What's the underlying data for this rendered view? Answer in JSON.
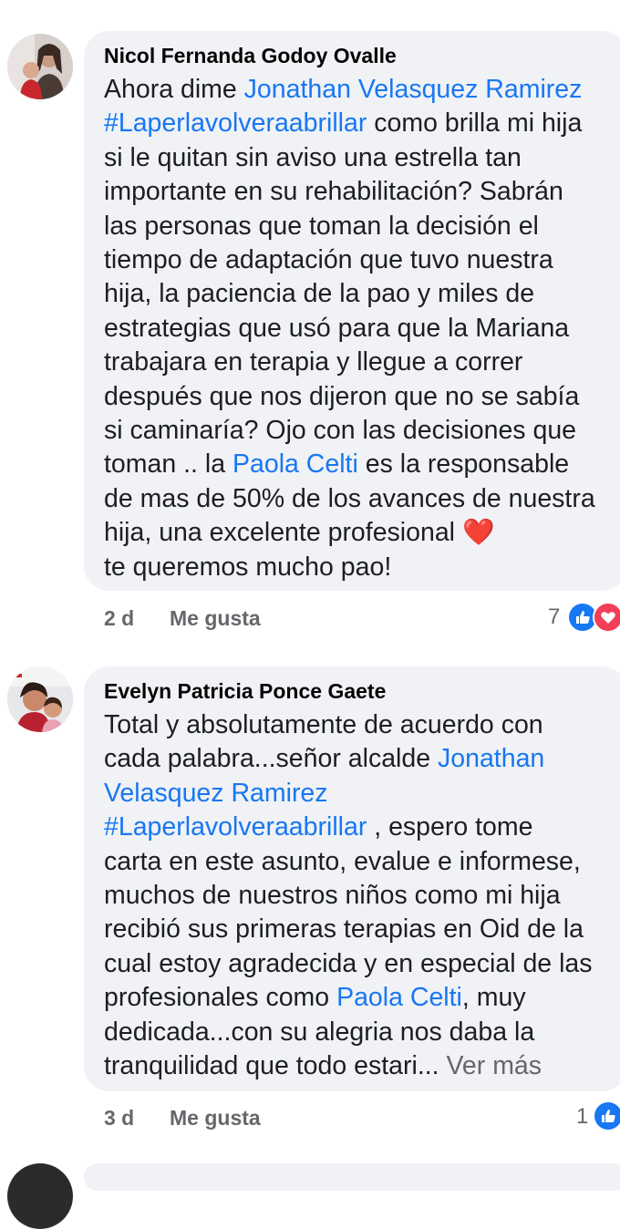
{
  "comments": [
    {
      "author": "Nicol Fernanda Godoy Ovalle",
      "lines": [
        [
          {
            "t": "Ahora dime "
          },
          {
            "t": "Jonathan Velasquez Ramirez",
            "m": true
          }
        ],
        [
          {
            "t": "#Laperlavolveraabrillar",
            "m": true
          },
          {
            "t": " como brilla mi hija"
          }
        ],
        [
          {
            "t": "si le quitan sin aviso una estrella tan"
          }
        ],
        [
          {
            "t": "importante en su rehabilitación? Sabrán"
          }
        ],
        [
          {
            "t": "las personas que toman la decisión el"
          }
        ],
        [
          {
            "t": "tiempo de adaptación que tuvo nuestra"
          }
        ],
        [
          {
            "t": "hija, la paciencia de la pao y miles de"
          }
        ],
        [
          {
            "t": "estrategias que usó para que la Mariana"
          }
        ],
        [
          {
            "t": "trabajara en terapia y llegue a correr"
          }
        ],
        [
          {
            "t": "después que nos dijeron que no se sabía"
          }
        ],
        [
          {
            "t": "si caminaría? Ojo con las decisiones que"
          }
        ],
        [
          {
            "t": "toman .. la "
          },
          {
            "t": "Paola Celti",
            "m": true
          },
          {
            "t": " es la responsable"
          }
        ],
        [
          {
            "t": "de mas de 50% de los avances de nuestra"
          }
        ],
        [
          {
            "t": "hija, una excelente profesional "
          },
          {
            "t": "❤️",
            "heart": true
          }
        ],
        [
          {
            "t": "te queremos mucho pao!"
          }
        ]
      ],
      "time": "2 d",
      "like_label": "Me gusta",
      "reaction_count": "7",
      "reactions": [
        "like-icon",
        "love-icon"
      ]
    },
    {
      "author": "Evelyn Patricia Ponce Gaete",
      "lines": [
        [
          {
            "t": "Total y absolutamente de acuerdo con"
          }
        ],
        [
          {
            "t": "cada palabra...señor alcalde "
          },
          {
            "t": "Jonathan",
            "m": true
          }
        ],
        [
          {
            "t": "Velasquez Ramirez",
            "m": true
          }
        ],
        [
          {
            "t": "#Laperlavolveraabrillar",
            "m": true
          },
          {
            "t": " , espero tome"
          }
        ],
        [
          {
            "t": "carta en este asunto, evalue e informese,"
          }
        ],
        [
          {
            "t": "muchos de nuestros niños como mi hija"
          }
        ],
        [
          {
            "t": "recibió sus primeras terapias en Oid de la"
          }
        ],
        [
          {
            "t": "cual estoy agradecida y en especial de las"
          }
        ],
        [
          {
            "t": "profesionales como "
          },
          {
            "t": "Paola Celti",
            "m": true
          },
          {
            "t": ", muy"
          }
        ],
        [
          {
            "t": "dedicada...con su alegria nos daba la"
          }
        ],
        [
          {
            "t": "tranquilidad que todo estari... "
          },
          {
            "t": "Ver más",
            "more": true
          }
        ]
      ],
      "time": "3 d",
      "like_label": "Me gusta",
      "reaction_count": "1",
      "reactions": [
        "like-icon"
      ]
    }
  ],
  "colors": {
    "mention": "#1877f2",
    "bubble": "#f0f2f5",
    "meta": "#65676b",
    "like": "#1877f2",
    "love": "#f33e58"
  }
}
